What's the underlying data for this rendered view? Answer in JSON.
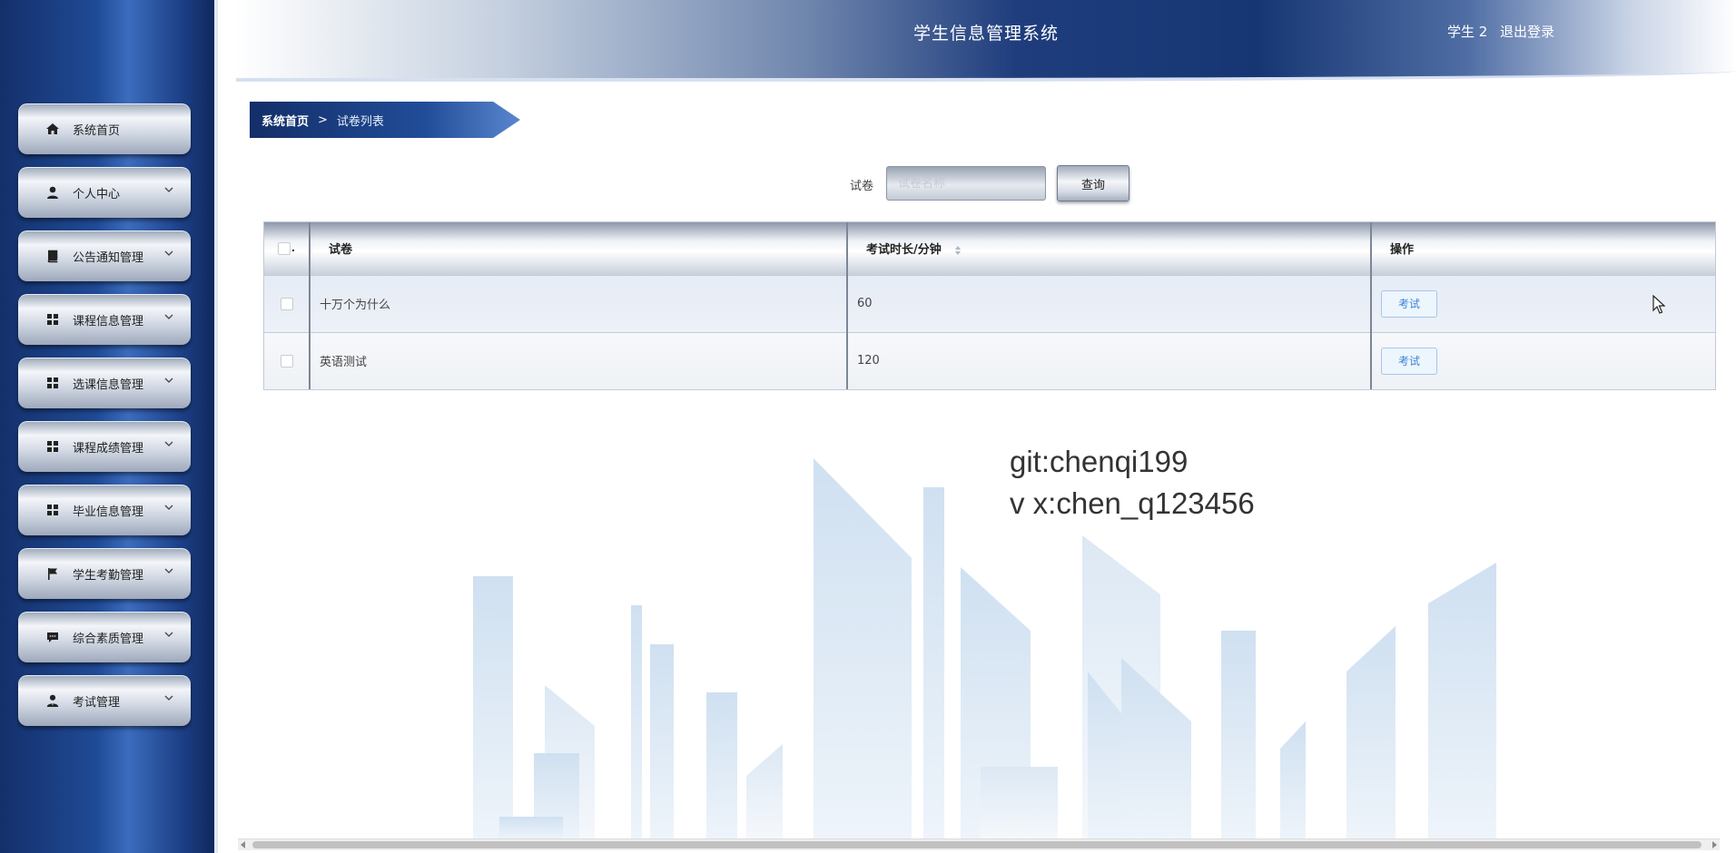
{
  "header": {
    "title": "学生信息管理系统",
    "user_label": "学生 2",
    "logout_label": "退出登录"
  },
  "sidebar": {
    "items": [
      {
        "label": "系统首页",
        "icon": "home-icon",
        "has_submenu": false
      },
      {
        "label": "个人中心",
        "icon": "user-icon",
        "has_submenu": true
      },
      {
        "label": "公告通知管理",
        "icon": "book-icon",
        "has_submenu": true
      },
      {
        "label": "课程信息管理",
        "icon": "grid-icon",
        "has_submenu": true
      },
      {
        "label": "选课信息管理",
        "icon": "grid-icon",
        "has_submenu": true
      },
      {
        "label": "课程成绩管理",
        "icon": "grid-icon",
        "has_submenu": true
      },
      {
        "label": "毕业信息管理",
        "icon": "grid-icon",
        "has_submenu": true
      },
      {
        "label": "学生考勤管理",
        "icon": "flag-icon",
        "has_submenu": true
      },
      {
        "label": "综合素质管理",
        "icon": "comment-icon",
        "has_submenu": true
      },
      {
        "label": "考试管理",
        "icon": "user-tie-icon",
        "has_submenu": true
      }
    ]
  },
  "breadcrumb": {
    "home": "系统首页",
    "separator": ">",
    "current": "试卷列表"
  },
  "search": {
    "label": "试卷",
    "placeholder": "试卷名称",
    "value": "",
    "button_label": "查询"
  },
  "table": {
    "header_check_suffix": ".",
    "columns": [
      "试卷",
      "考试时长/分钟",
      "操作"
    ],
    "rows": [
      {
        "name": "十万个为什么",
        "duration": "60",
        "action_label": "考试"
      },
      {
        "name": "英语测试",
        "duration": "120",
        "action_label": "考试"
      }
    ]
  },
  "watermark": {
    "line1": "git:chenqi199",
    "line2": "v x:chen_q123456"
  },
  "colors": {
    "sidebar_blue": "#1f4a95",
    "header_navy": "#163673",
    "action_blue": "#3a86d4"
  }
}
